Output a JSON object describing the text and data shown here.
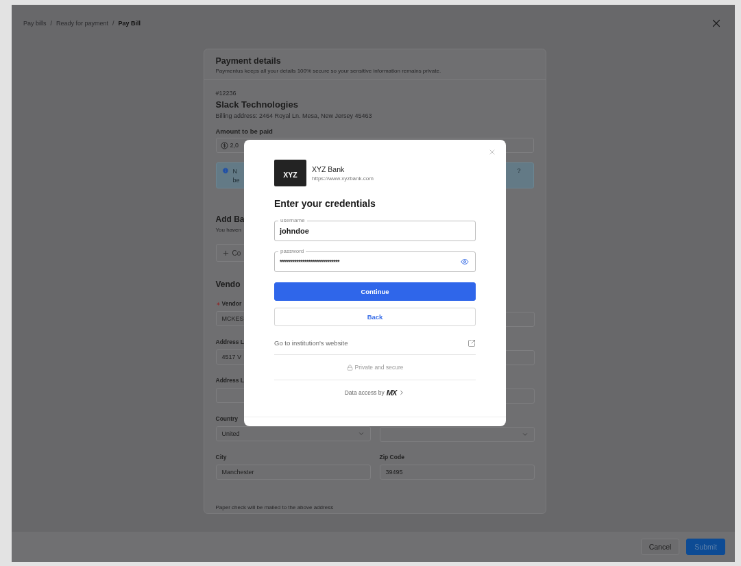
{
  "breadcrumb": {
    "separator": "/",
    "items": [
      {
        "label": "Pay bills",
        "current": false
      },
      {
        "label": "Ready for payment",
        "current": false
      },
      {
        "label": "Pay Bill",
        "current": true
      }
    ]
  },
  "payment_details": {
    "title": "Payment details",
    "subtitle": "Paymentus keeps all your details 100% secure so your sensitive information remains private."
  },
  "bill": {
    "number": "#12236",
    "vendor": "Slack Technologies",
    "billing_address": "Billing address: 2464 Royal Ln. Mesa, New Jersey 45463",
    "amount_label": "Amount to be paid",
    "amount_value": "2,0"
  },
  "info_note": {
    "line_1": "N",
    "line_2": "be",
    "tail": "?"
  },
  "add_bank": {
    "title": "Add Ba",
    "subtitle": "You haven",
    "button": "Co"
  },
  "vendor": {
    "title": "Vendo",
    "rows": [
      {
        "fields": [
          {
            "kind": "text",
            "label": "Vendor",
            "required": true,
            "value": "MCKES"
          },
          {
            "kind": "text"
          }
        ]
      },
      {
        "fields": [
          {
            "kind": "text",
            "label": "Address L",
            "required": false,
            "value": "4517 V"
          },
          {
            "kind": "text"
          }
        ]
      },
      {
        "fields": [
          {
            "kind": "text",
            "label": "Address L",
            "required": false
          },
          {
            "kind": "text"
          }
        ]
      },
      {
        "fields": [
          {
            "kind": "select",
            "label": "Country",
            "required": false,
            "value": "United"
          },
          {
            "kind": "select"
          }
        ]
      },
      {
        "fields": [
          {
            "kind": "text",
            "label": "City",
            "required": false,
            "value": "Manchester"
          },
          {
            "kind": "text",
            "label": "Zip Code",
            "required": false,
            "value": "39495"
          }
        ]
      }
    ],
    "note": "Paper check will be mailed to the above address"
  },
  "modal": {
    "bank": {
      "logo": "XYZ",
      "name": "XYZ Bank",
      "url": "https://www.xyzbank.com"
    },
    "heading": "Enter your credentials",
    "fields": [
      {
        "kind": "text",
        "label": "username",
        "value": "johndoe"
      },
      {
        "kind": "password",
        "label": "password",
        "value": "*****************************"
      }
    ],
    "buttons": [
      {
        "label": "Continue",
        "primary": true
      },
      {
        "label": "Back",
        "primary": false
      }
    ],
    "website_link": "Go to institution's website",
    "security_note": "Private and secure",
    "data_access": {
      "text": "Data access by",
      "brand": "MX"
    }
  },
  "footer": {
    "buttons": [
      {
        "label": "Cancel",
        "primary": false
      },
      {
        "label": "Submit",
        "primary": true
      }
    ]
  }
}
